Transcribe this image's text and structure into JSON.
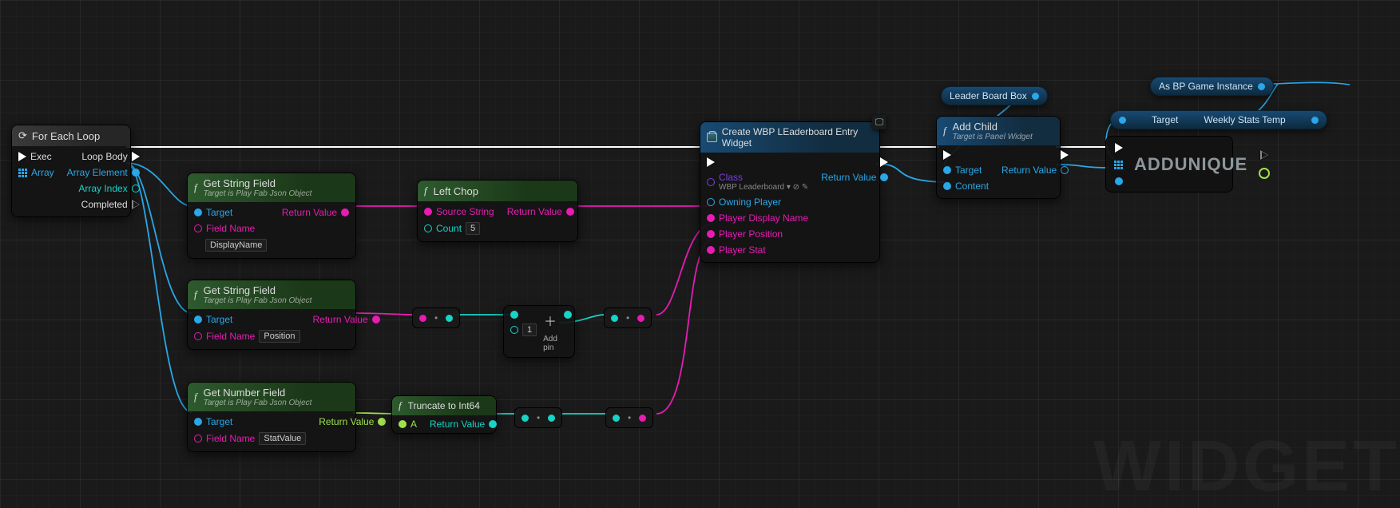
{
  "watermark": "WIDGET",
  "nodes": {
    "foreach": {
      "title": "For Each Loop",
      "exec_in": "Exec",
      "array_in": "Array",
      "loop_body": "Loop Body",
      "array_element": "Array Element",
      "array_index": "Array Index",
      "completed": "Completed"
    },
    "get_string_1": {
      "title": "Get String Field",
      "subtitle": "Target is Play Fab Json Object",
      "target": "Target",
      "field_name": "Field Name",
      "field_value": "DisplayName",
      "return_value": "Return Value"
    },
    "get_string_2": {
      "title": "Get String Field",
      "subtitle": "Target is Play Fab Json Object",
      "target": "Target",
      "field_name": "Field Name",
      "field_value": "Position",
      "return_value": "Return Value"
    },
    "get_number": {
      "title": "Get Number Field",
      "subtitle": "Target is Play Fab Json Object",
      "target": "Target",
      "field_name": "Field Name",
      "field_value": "StatValue",
      "return_value": "Return Value"
    },
    "left_chop": {
      "title": "Left Chop",
      "source_string": "Source String",
      "count": "Count",
      "count_value": "5",
      "return_value": "Return Value"
    },
    "truncate": {
      "title": "Truncate to Int64",
      "a_in": "A",
      "return_value": "Return Value"
    },
    "add_box": {
      "one": "1",
      "add_pin": "Add pin"
    },
    "create_widget": {
      "title": "Create WBP LEaderboard Entry Widget",
      "class_label": "Class",
      "class_value": "WBP Leaderboard",
      "owning_player": "Owning Player",
      "player_display_name": "Player Display Name",
      "player_position": "Player Position",
      "player_stat": "Player Stat",
      "return_value": "Return Value"
    },
    "add_child": {
      "title": "Add Child",
      "subtitle": "Target is Panel Widget",
      "target": "Target",
      "content": "Content",
      "return_value": "Return Value"
    },
    "addunique": {
      "title": "ADDUNIQUE"
    }
  },
  "pills": {
    "leader_board_box": "Leader Board Box",
    "as_bp_game_instance": "As BP Game Instance",
    "target": "Target",
    "weekly_stats_temp": "Weekly Stats Temp"
  }
}
